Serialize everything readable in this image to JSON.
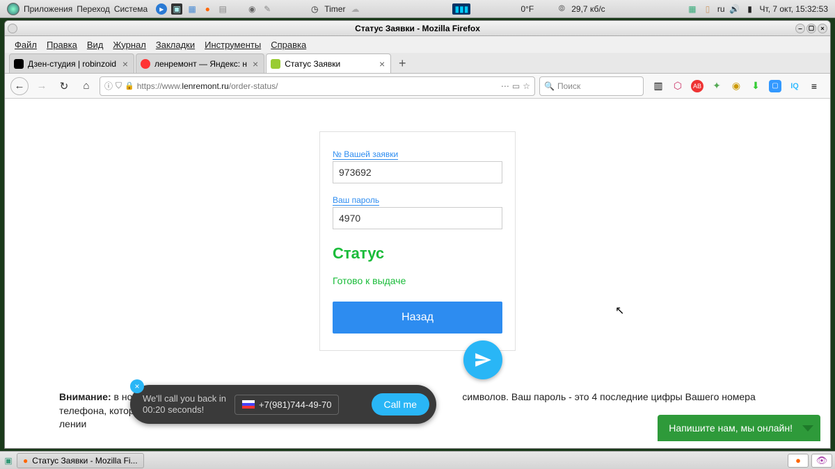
{
  "syspanel": {
    "menus": [
      "Приложения",
      "Переход",
      "Система"
    ],
    "timer": "Timer",
    "temp": "0°F",
    "net_speed": "29,7 кб/с",
    "lang": "ru",
    "date": "Чт,  7 окт, 15:32:53"
  },
  "firefox": {
    "window_title": "Статус Заявки - Mozilla Firefox",
    "menubar": [
      "Файл",
      "Правка",
      "Вид",
      "Журнал",
      "Закладки",
      "Инструменты",
      "Справка"
    ],
    "tabs": [
      {
        "label": "Дзен-студия | robinzoid",
        "favicon": "dzen"
      },
      {
        "label": "ленремонт — Яндекс: н",
        "favicon": "yandex"
      },
      {
        "label": "Статус Заявки",
        "favicon": "lenr",
        "active": true
      }
    ],
    "url_display_host": "lenremont.ru",
    "url_prefix": "https://www.",
    "url_suffix": "/order-status/",
    "search_placeholder": "Поиск"
  },
  "form": {
    "order_label": "№ Вашей заявки",
    "order_value": "973692",
    "password_label": "Ваш пароль",
    "password_value": "4970",
    "status_heading": "Статус",
    "status_value": "Готово к выдаче",
    "back_button": "Назад"
  },
  "warning": {
    "prefix": "Внимание:",
    "text_before": " в номер",
    "text_after": "символов. Ваш пароль - это 4 последние цифры Вашего номера телефона, который Вы оставл",
    "text_tail": "лении"
  },
  "callback": {
    "line1": "We'll call you back in",
    "line2": "00:20 seconds!",
    "phone": "+7(981)744-49-70",
    "button": "Call me"
  },
  "chat": {
    "label": "Напишите нам, мы онлайн!"
  },
  "taskbar": {
    "task1": "Статус Заявки - Mozilla Fi..."
  }
}
